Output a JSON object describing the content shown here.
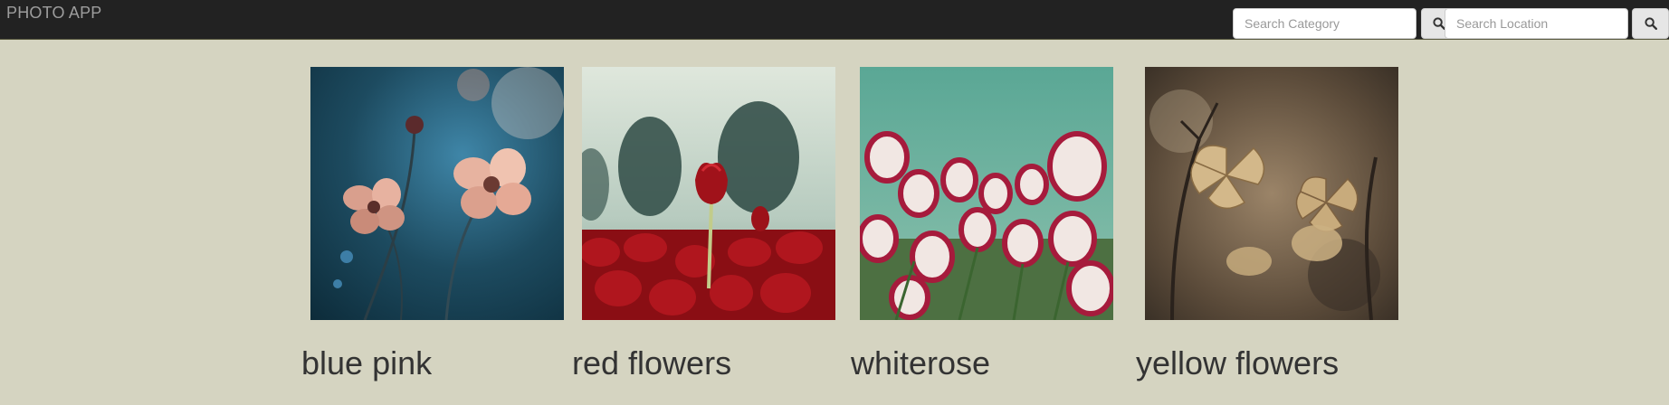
{
  "navbar": {
    "brand": "PHOTO APP",
    "category_search": {
      "placeholder": "Search Category",
      "icon": "search-icon"
    },
    "location_search": {
      "placeholder": "Search Location",
      "icon": "search-icon"
    }
  },
  "gallery": {
    "items": [
      {
        "caption": "blue pink"
      },
      {
        "caption": "red flowers"
      },
      {
        "caption": "whiterose"
      },
      {
        "caption": "yellow flowers"
      }
    ]
  },
  "colors": {
    "navbar_bg": "#222222",
    "page_bg": "#d5d4c1",
    "caption_text": "#333333"
  }
}
